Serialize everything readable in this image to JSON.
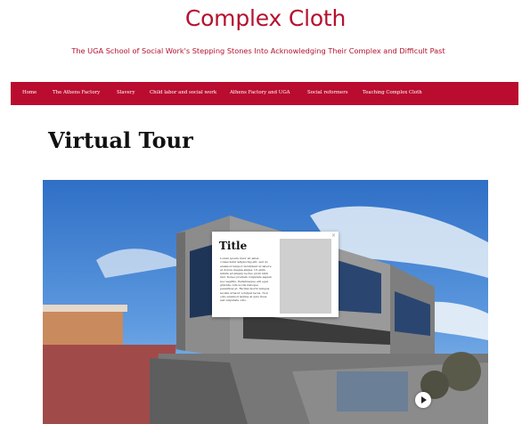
{
  "site": {
    "title": "Complex Cloth",
    "tagline": "The UGA School of Social Work's Stepping Stones Into Acknowledging Their Complex and Difficult Past"
  },
  "nav": {
    "items": [
      {
        "label": "Home"
      },
      {
        "label": "The Athens Factory"
      },
      {
        "label": "Slavery"
      },
      {
        "label": "Child labor and social work"
      },
      {
        "label": "Athens Factory and UGA"
      },
      {
        "label": "Social reformers"
      },
      {
        "label": "Teaching Complex Cloth"
      }
    ]
  },
  "page": {
    "title": "Virtual Tour"
  },
  "tour": {
    "hotspot_symbol": "!",
    "card": {
      "title": "Title",
      "body": "Lorem ipsum dolor sit amet, consectetur adipiscing elit, sed do eiusmod tempor incididunt ut labore et dolore magna aliqua. Ut enim minim ad aliquip lectus proin nibh nisl. Donec pretium vulputate sapien nec sagittis. Pellentesque elit eget gravida cum sociis natoque penatibus et. Facilisi morbi tempus iaculis urna id volutpat lacus. Non odio euismod lacinia at quis risus sed vulputate odio.",
      "close_symbol": "×"
    },
    "play_icon": "play-icon"
  },
  "colors": {
    "brand": "#ba0c2f",
    "sky": "#3f7fd0"
  }
}
